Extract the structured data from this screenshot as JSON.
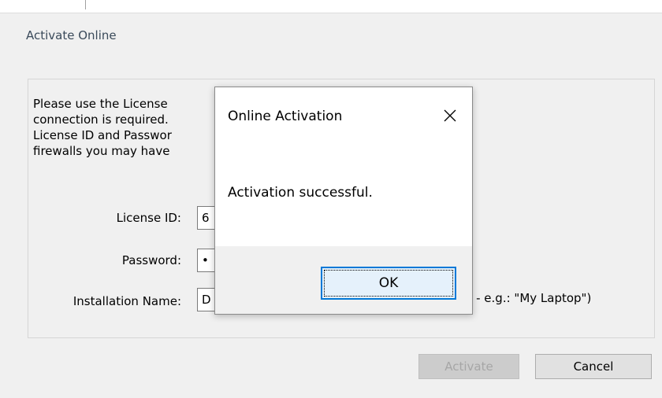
{
  "window": {
    "title": "Activate Online"
  },
  "instructions": {
    "line1": "Please use the License                                    ctivate.  An Internet",
    "line2": "connection is required.                                 double-check that the",
    "line3": "License ID and Passwor                                    ble any personal",
    "line4": "firewalls you may have"
  },
  "form": {
    "license_label": "License ID:",
    "license_value": "6",
    "password_label": "Password:",
    "password_value": "•",
    "installation_label": "Installation Name:",
    "installation_value": "D",
    "installation_hint": "al - e.g.: \"My Laptop\")"
  },
  "buttons": {
    "activate": "Activate",
    "cancel": "Cancel"
  },
  "modal": {
    "title": "Online Activation",
    "close_glyph": "✕",
    "message": "Activation successful.",
    "ok": "OK"
  }
}
